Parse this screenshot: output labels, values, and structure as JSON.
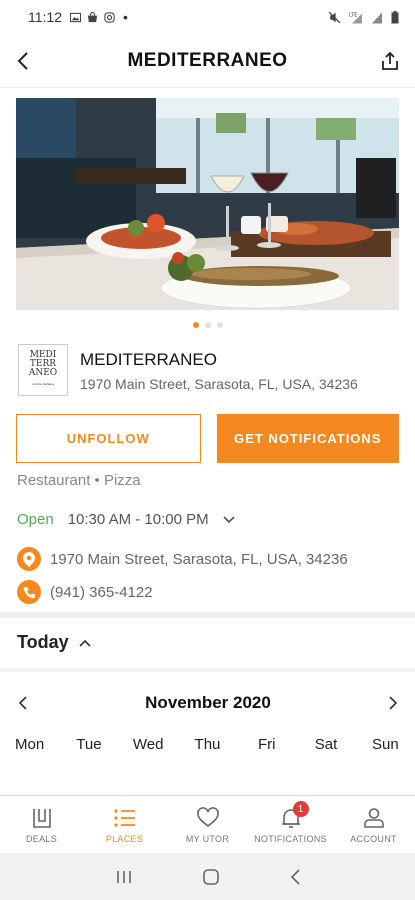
{
  "status_bar": {
    "time": "11:12",
    "dot": "•",
    "icons_left": [
      "image-icon",
      "bag-icon",
      "instagram-icon"
    ],
    "icons_right": [
      "mute-icon",
      "lte-signal-icon",
      "signal-icon",
      "battery-icon"
    ]
  },
  "header": {
    "title": "MEDITERRANEO",
    "back_icon": "chevron-left-icon",
    "share_icon": "share-icon"
  },
  "hero": {
    "carousel_count": 3,
    "carousel_active": 0
  },
  "business": {
    "logo_lines": [
      "MEDI",
      "TERR",
      "ANEO"
    ],
    "logo_tagline": "cucina italiana",
    "name": "MEDITERRANEO",
    "address": "1970 Main Street, Sarasota, FL, USA, 34236"
  },
  "actions": {
    "unfollow_label": "UNFOLLOW",
    "notify_label": "GET NOTIFICATIONS"
  },
  "category": "Restaurant • Pizza",
  "hours": {
    "status": "Open",
    "range": "10:30 AM - 10:00 PM"
  },
  "contact": {
    "address": "1970 Main Street, Sarasota, FL, USA, 34236",
    "phone": "(941) 365-4122"
  },
  "today": {
    "label": "Today"
  },
  "calendar": {
    "month": "November 2020",
    "weekdays": [
      "Mon",
      "Tue",
      "Wed",
      "Thu",
      "Fri",
      "Sat",
      "Sun"
    ]
  },
  "tabs": [
    {
      "label": "DEALS",
      "icon": "deals-icon"
    },
    {
      "label": "PLACES",
      "icon": "list-icon"
    },
    {
      "label": "MY UTOR",
      "icon": "heart-icon"
    },
    {
      "label": "NOTIFICATIONS",
      "icon": "bell-icon",
      "badge": "1"
    },
    {
      "label": "ACCOUNT",
      "icon": "person-icon"
    }
  ],
  "active_tab": "PLACES",
  "colors": {
    "accent": "#f5891f",
    "open_green": "#4caf50",
    "badge_red": "#e53935"
  }
}
